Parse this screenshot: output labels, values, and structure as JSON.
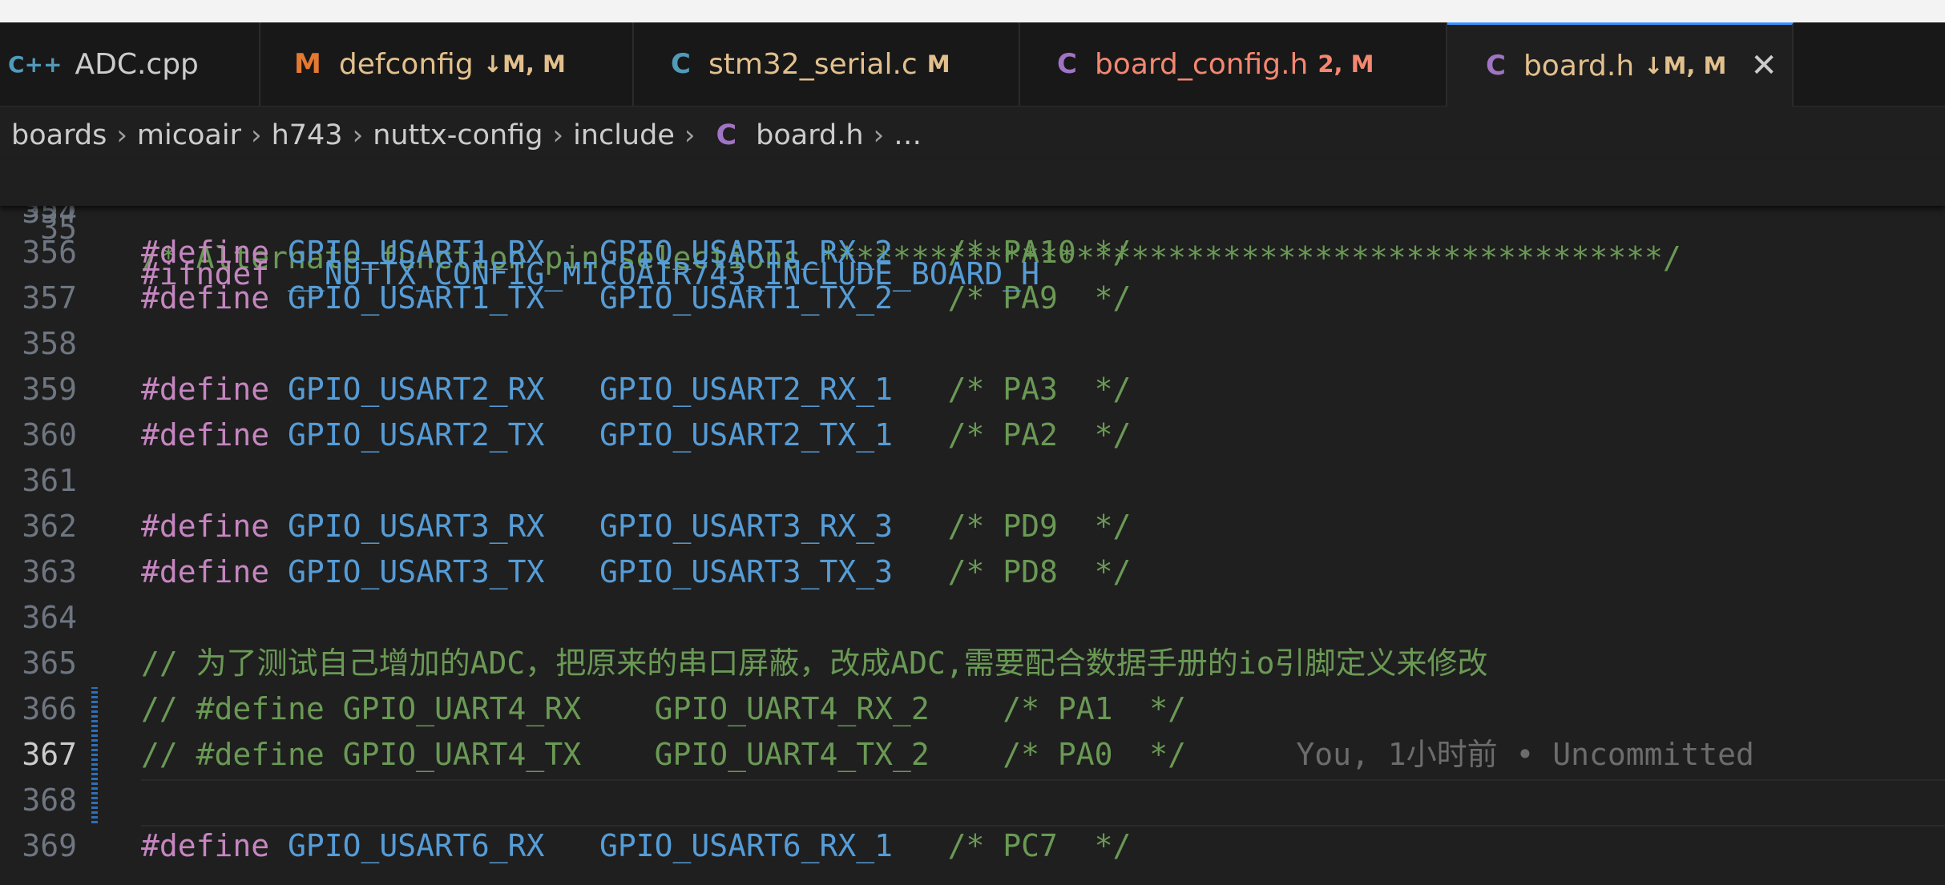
{
  "tabs": [
    {
      "icon": "C++",
      "name": "ADC.cpp",
      "status": "",
      "icon_color": "#519aba",
      "name_color": "#cccccc",
      "status_color": "#cccccc"
    },
    {
      "icon": "M",
      "name": "defconfig",
      "status": "↓M, M",
      "icon_color": "#e37933",
      "name_color": "#e2c08d",
      "status_color": "#e2c08d"
    },
    {
      "icon": "C",
      "name": "stm32_serial.c",
      "status": "M",
      "icon_color": "#519aba",
      "name_color": "#e2c08d",
      "status_color": "#e2c08d"
    },
    {
      "icon": "C",
      "name": "board_config.h",
      "status": "2, M",
      "icon_color": "#a074c4",
      "name_color": "#f48771",
      "status_color": "#f48771"
    },
    {
      "icon": "C",
      "name": "board.h",
      "status": "↓M, M",
      "icon_color": "#a074c4",
      "name_color": "#e2c08d",
      "status_color": "#e2c08d",
      "close": "✕"
    }
  ],
  "breadcrumb": {
    "items": [
      "boards",
      "micoair",
      "h743",
      "nuttx-config",
      "include"
    ],
    "file_icon": "C",
    "file": "board.h",
    "more": "…",
    "separator": "›"
  },
  "sticky_line": {
    "num": "35",
    "kw": "#ifndef",
    "text": " __NUTTX_CONFIG_MICOAIR743_INCLUDE_BOARD_H"
  },
  "partial_top_line": {
    "num": "354",
    "text": "/* Alternate function pin selections **********************************************/"
  },
  "lines": [
    {
      "num": "355",
      "kw": "",
      "mac": "",
      "cm": ""
    },
    {
      "num": "356",
      "kw": "#define",
      "mac": " GPIO_USART1_RX   GPIO_USART1_RX_2   ",
      "cm": "/* PA10 */"
    },
    {
      "num": "357",
      "kw": "#define",
      "mac": " GPIO_USART1_TX   GPIO_USART1_TX_2   ",
      "cm": "/* PA9  */"
    },
    {
      "num": "358",
      "kw": "",
      "mac": "",
      "cm": ""
    },
    {
      "num": "359",
      "kw": "#define",
      "mac": " GPIO_USART2_RX   GPIO_USART2_RX_1   ",
      "cm": "/* PA3  */"
    },
    {
      "num": "360",
      "kw": "#define",
      "mac": " GPIO_USART2_TX   GPIO_USART2_TX_1   ",
      "cm": "/* PA2  */"
    },
    {
      "num": "361",
      "kw": "",
      "mac": "",
      "cm": ""
    },
    {
      "num": "362",
      "kw": "#define",
      "mac": " GPIO_USART3_RX   GPIO_USART3_RX_3   ",
      "cm": "/* PD9  */"
    },
    {
      "num": "363",
      "kw": "#define",
      "mac": " GPIO_USART3_TX   GPIO_USART3_TX_3   ",
      "cm": "/* PD8  */"
    },
    {
      "num": "364",
      "kw": "",
      "mac": "",
      "cm": ""
    },
    {
      "num": "365",
      "kw": "",
      "mac": "",
      "cm": "// 为了测试自己增加的ADC，把原来的串口屏蔽，改成ADC,需要配合数据手册的io引脚定义来修改"
    },
    {
      "num": "366",
      "kw": "",
      "mac": "",
      "cm": "// #define GPIO_UART4_RX    GPIO_UART4_RX_2    /* PA1  */"
    },
    {
      "num": "367",
      "kw": "",
      "mac": "",
      "cm": "// #define GPIO_UART4_TX    GPIO_UART4_TX_2    /* PA0  */",
      "blame": "      You, 1小时前 • Uncommitted"
    },
    {
      "num": "368",
      "kw": "",
      "mac": "",
      "cm": ""
    },
    {
      "num": "369",
      "kw": "#define",
      "mac": " GPIO_USART6_RX   GPIO_USART6_RX_1   ",
      "cm": "/* PC7  */"
    }
  ]
}
